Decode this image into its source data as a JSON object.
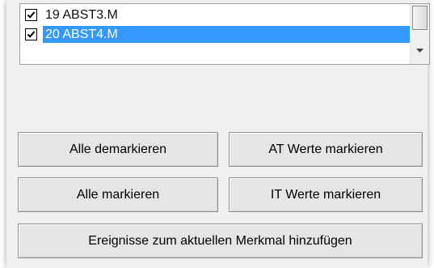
{
  "list": {
    "items": [
      {
        "label": "19  ABST3.M",
        "checked": true,
        "selected": false
      },
      {
        "label": "20  ABST4.M",
        "checked": true,
        "selected": true
      }
    ]
  },
  "buttons": {
    "demark_all": "Alle demarkieren",
    "mark_at": "AT Werte markieren",
    "mark_all": "Alle markieren",
    "mark_it": "IT Werte markieren",
    "add_events": "Ereignisse zum aktuellen Merkmal hinzufügen"
  },
  "colors": {
    "selection": "#3399ff",
    "panel": "#f0f0f0"
  },
  "icons": {
    "checkbox": "check-mark",
    "scroll_down": "triangle-down"
  }
}
